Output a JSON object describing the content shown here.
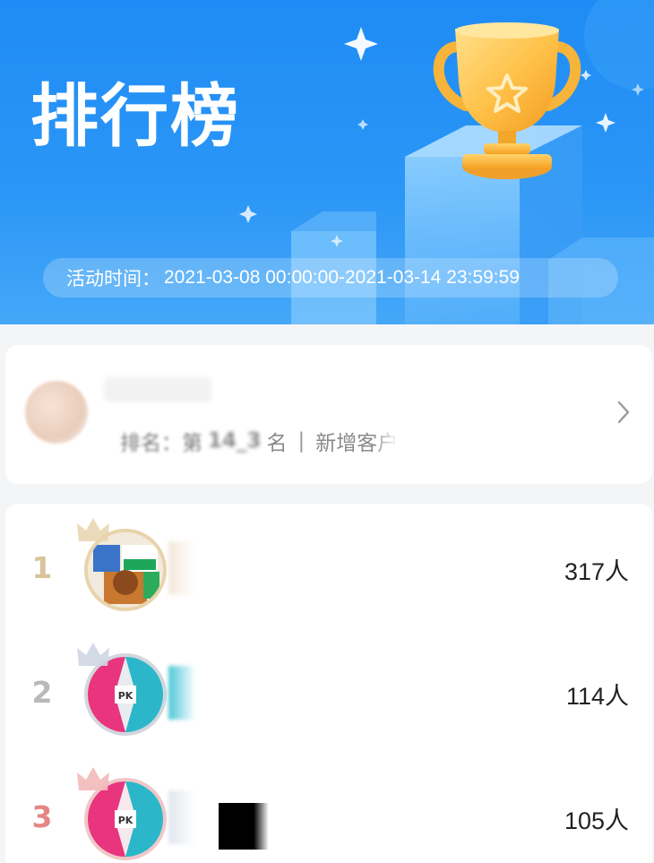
{
  "header": {
    "title": "排行榜",
    "time_label": "活动时间：",
    "time_range": "2021-03-08 00:00:00-2021-03-14 23:59:59",
    "bg_color": "#1f8cf5",
    "trophy_icon": "trophy-icon"
  },
  "my_card": {
    "rank_prefix": "排名：第",
    "rank_value": "14_3",
    "rank_suffix": "名",
    "divider": "|",
    "metric_label": "新增客户",
    "chevron_icon": "chevron-right-icon"
  },
  "leaderboard": {
    "rows": [
      {
        "rank": "1",
        "count": "317人",
        "rank_color": "#d9c39a",
        "crown_color": "#e7d2ad",
        "border_color": "#e8d3ab"
      },
      {
        "rank": "2",
        "count": "114人",
        "rank_color": "#b9b9b9",
        "crown_color": "#cfd6e3",
        "border_color": "#d3d6dd"
      },
      {
        "rank": "3",
        "count": "105人",
        "rank_color": "#e58585",
        "crown_color": "#f2b9b9",
        "border_color": "#f0c7c7"
      }
    ]
  }
}
